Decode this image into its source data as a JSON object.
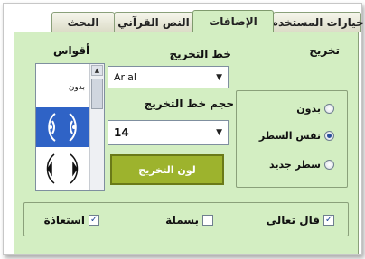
{
  "tabs": [
    {
      "label": "خيارات المستخدم",
      "active": false
    },
    {
      "label": "الإضافات",
      "active": true
    },
    {
      "label": "النص القرآني",
      "active": false
    },
    {
      "label": "البحث",
      "active": false
    }
  ],
  "takhrij": {
    "label": "تخريج",
    "options": [
      {
        "label": "بدون",
        "checked": false
      },
      {
        "label": "نفس السطر",
        "checked": true
      },
      {
        "label": "سطر جديد",
        "checked": false
      }
    ]
  },
  "font": {
    "label": "خط التخريج",
    "value": "Arial"
  },
  "size": {
    "label": "حجم خط التخريج",
    "value": "14"
  },
  "color_button": {
    "label": "لون التخريج",
    "color": "#9db32d"
  },
  "brackets": {
    "label": "أقواس",
    "items": [
      {
        "label": "بدون",
        "selected": false
      },
      {
        "label": "",
        "selected": true
      },
      {
        "label": "",
        "selected": false
      }
    ]
  },
  "checkboxes": [
    {
      "label": "قال تعالى",
      "checked": true
    },
    {
      "label": "بسملة",
      "checked": false
    },
    {
      "label": "استعاذة",
      "checked": true
    }
  ],
  "colors": {
    "panel": "#d3eec2",
    "selection": "#2f63c6",
    "border": "#8aa07a"
  }
}
